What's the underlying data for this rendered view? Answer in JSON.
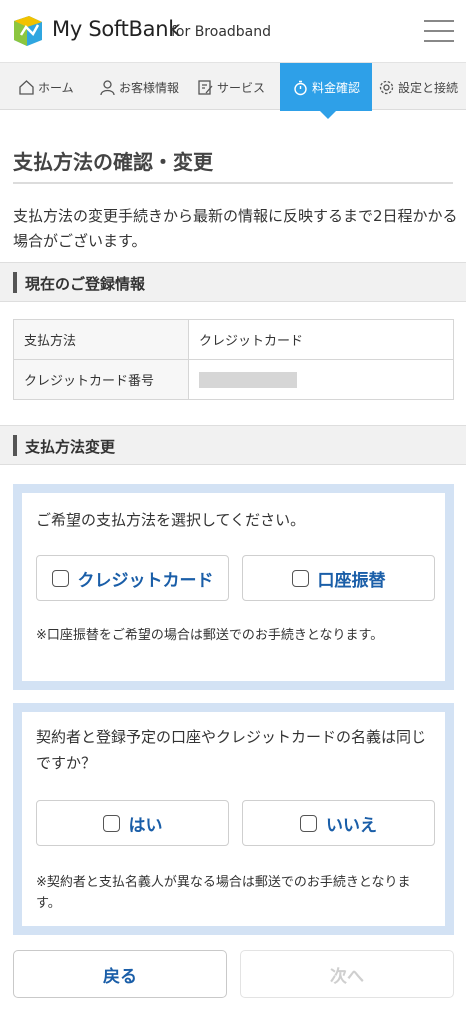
{
  "header": {
    "brand": "My SoftBank",
    "brand_sub": "for Broadband"
  },
  "nav": {
    "items": [
      {
        "label": "ホーム",
        "icon": "home-icon"
      },
      {
        "label": "お客様情報",
        "icon": "person-icon"
      },
      {
        "label": "サービス",
        "icon": "edit-document-icon"
      },
      {
        "label": "料金確認",
        "icon": "stopwatch-icon",
        "active": true
      },
      {
        "label": "設定と接続",
        "icon": "gear-icon"
      }
    ]
  },
  "page": {
    "title": "支払方法の確認・変更",
    "notice": "支払方法の変更手続きから最新の情報に反映するまで2日程かかる場合がございます。"
  },
  "current_info": {
    "heading": "現在のご登録情報",
    "rows": [
      {
        "label": "支払方法",
        "value": "クレジットカード"
      },
      {
        "label": "クレジットカード番号",
        "value": ""
      }
    ]
  },
  "change": {
    "heading": "支払方法変更",
    "method": {
      "question": "ご希望の支払方法を選択してください。",
      "options": [
        "クレジットカード",
        "口座振替"
      ],
      "note": "※口座振替をご希望の場合は郵送でのお手続きとなります。"
    },
    "same_name": {
      "question": "契約者と登録予定の口座やクレジットカードの名義は同じですか？",
      "options": [
        "はい",
        "いいえ"
      ],
      "note": "※契約者と支払名義人が異なる場合は郵送でのお手続きとなります。"
    }
  },
  "buttons": {
    "back": "戻る",
    "next": "次へ"
  },
  "colors": {
    "accent": "#2ea0e8",
    "link_blue": "#1a5ea8",
    "panel_bg": "#d3e2f4"
  }
}
